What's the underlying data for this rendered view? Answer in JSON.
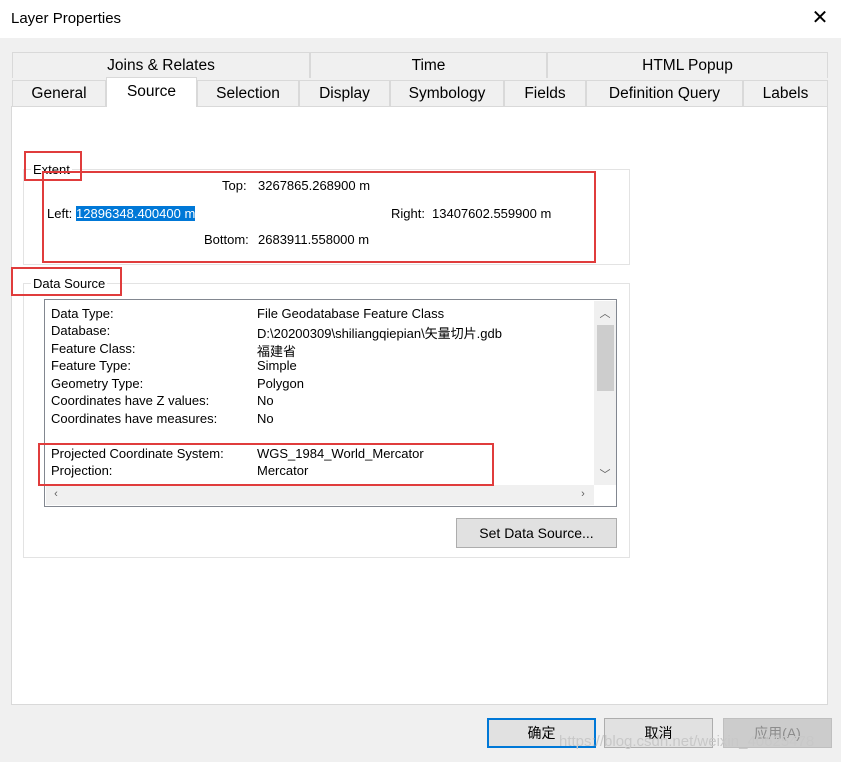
{
  "window": {
    "title": "Layer Properties",
    "close_glyph": "✕"
  },
  "tabs_back": [
    {
      "label": "Joins & Relates"
    },
    {
      "label": "Time"
    },
    {
      "label": "HTML Popup"
    }
  ],
  "tabs_front": [
    {
      "label": "General"
    },
    {
      "label": "Source",
      "active": true
    },
    {
      "label": "Selection"
    },
    {
      "label": "Display"
    },
    {
      "label": "Symbology"
    },
    {
      "label": "Fields"
    },
    {
      "label": "Definition Query"
    },
    {
      "label": "Labels"
    }
  ],
  "extent": {
    "group_label": "Extent",
    "top_label": "Top:",
    "top_value": "3267865.268900 m",
    "left_label": "Left:",
    "left_value": "12896348.400400 m",
    "right_label": "Right:",
    "right_value": "13407602.559900 m",
    "bottom_label": "Bottom:",
    "bottom_value": "2683911.558000 m"
  },
  "data_source": {
    "group_label": "Data Source",
    "rows": [
      {
        "key": "Data Type:",
        "value": "File Geodatabase Feature Class"
      },
      {
        "key": "Database:",
        "value": "D:\\20200309\\shiliangqiepian\\矢量切片.gdb"
      },
      {
        "key": "Feature Class:",
        "value": "福建省"
      },
      {
        "key": "Feature Type:",
        "value": "Simple"
      },
      {
        "key": "Geometry Type:",
        "value": "Polygon"
      },
      {
        "key": "Coordinates have Z values:",
        "value": "No"
      },
      {
        "key": "Coordinates have measures:",
        "value": "No"
      },
      {
        "key": "",
        "value": ""
      },
      {
        "key": "Projected Coordinate System:",
        "value": "WGS_1984_World_Mercator"
      },
      {
        "key": "Projection:",
        "value": "Mercator"
      }
    ],
    "set_button": "Set Data Source..."
  },
  "footer": {
    "ok": "确定",
    "cancel": "取消",
    "apply": "应用(A)"
  },
  "watermark": "https://blog.csdn.net/weixin_40625478",
  "colors": {
    "selection": "#0078d7",
    "highlight_box": "#e03c3c"
  }
}
